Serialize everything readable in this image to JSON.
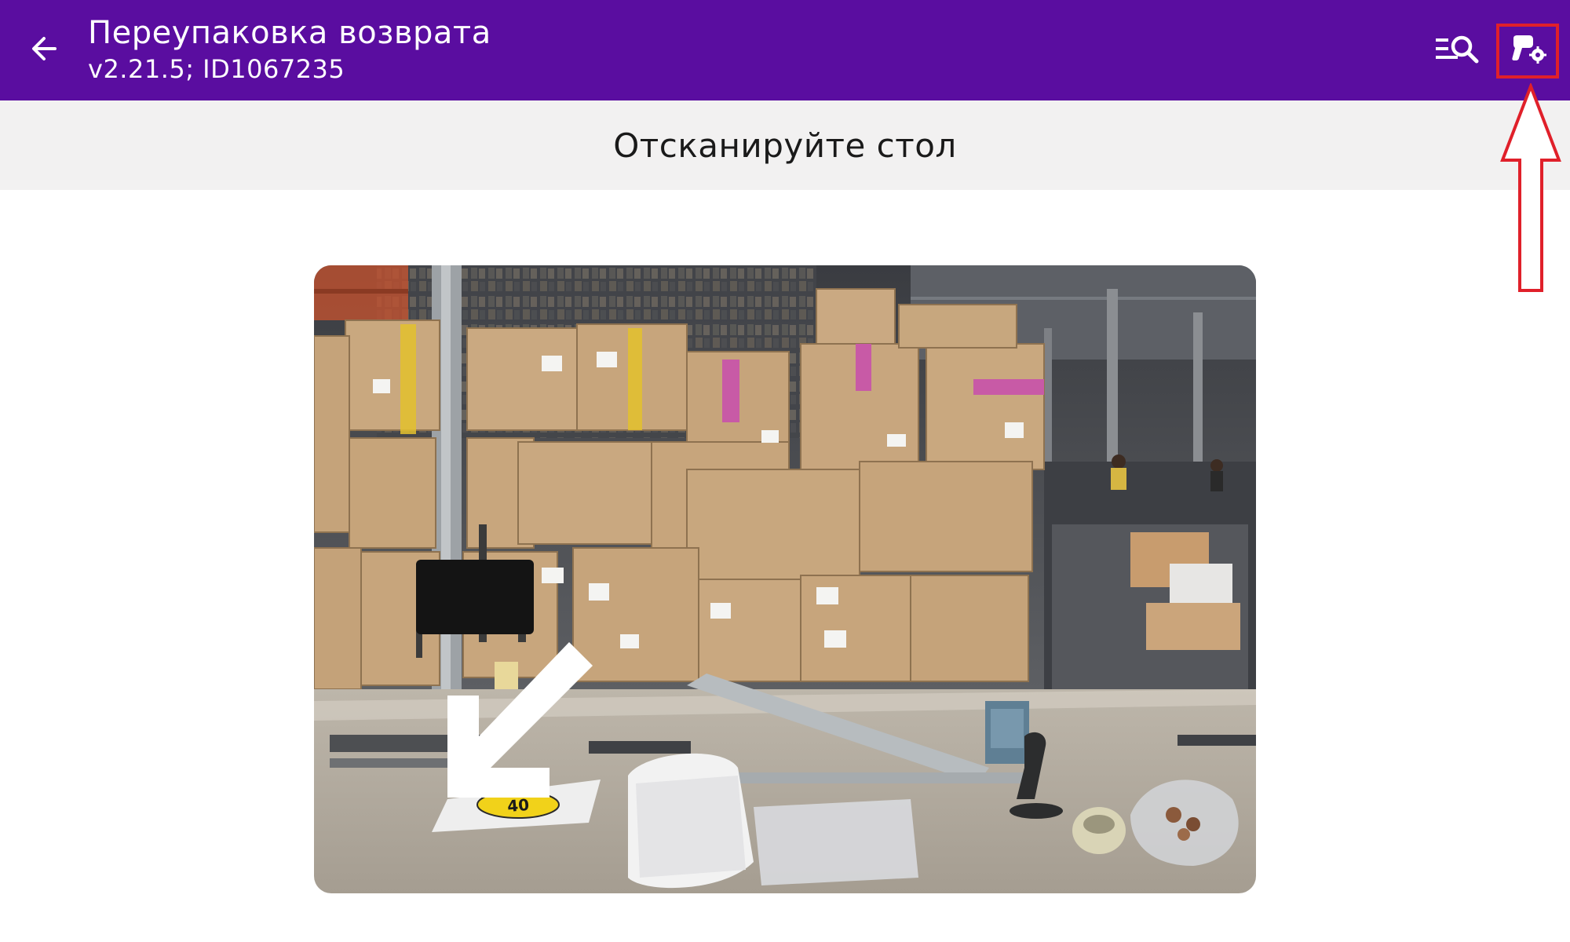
{
  "app_bar": {
    "title": "Переупаковка возврата",
    "subtitle": "v2.21.5; ID1067235",
    "back_icon": "arrow-left-icon",
    "search_icon": "list-search-icon",
    "settings_icon": "workstation-settings-icon",
    "background_color": "#5a0da0"
  },
  "instruction": {
    "text": "Отсканируйте стол"
  },
  "annotation": {
    "highlight_color": "#e0202a",
    "target": "settings-button"
  },
  "illustration": {
    "label_number": "40"
  }
}
